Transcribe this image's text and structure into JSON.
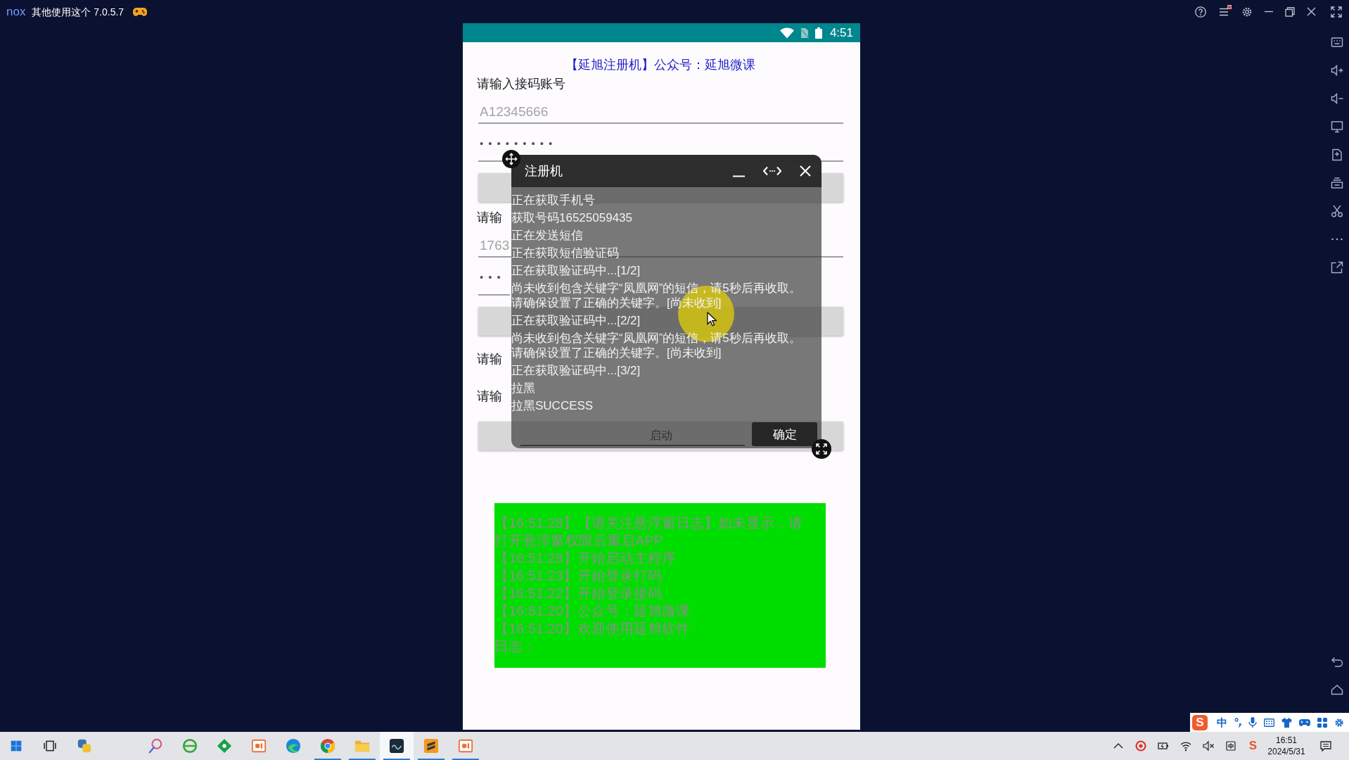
{
  "window": {
    "logo": "nox",
    "title": "其他使用这个 7.0.5.7",
    "menu_badge": true
  },
  "phone": {
    "status_bar": {
      "time": "4:51"
    },
    "heading": "【延旭注册机】公众号：延旭微课",
    "form": [
      {
        "kind": "label",
        "text": "请输入接码账号"
      },
      {
        "kind": "field",
        "placeholder": "A12345666"
      },
      {
        "kind": "password",
        "value": "•••••••••"
      },
      {
        "kind": "button"
      },
      {
        "kind": "label",
        "text": "请输"
      },
      {
        "kind": "field",
        "placeholder": "1763"
      },
      {
        "kind": "password",
        "value": "•••"
      },
      {
        "kind": "button"
      },
      {
        "kind": "row",
        "fields": [
          {
            "label": "请输"
          }
        ]
      },
      {
        "kind": "row",
        "fields": [
          {
            "label": "请输"
          }
        ]
      },
      {
        "kind": "button",
        "label": "启动"
      }
    ],
    "log": {
      "entries": [
        {
          "lines": [
            "【16:51:28】【请关注悬浮窗日志】如未显示，请",
            "打开悬浮窗权限后重启APP"
          ]
        },
        {
          "lines": [
            "【16:51:28】开始启动主程序"
          ]
        },
        {
          "lines": [
            "【16:51:23】开始登录打码"
          ]
        },
        {
          "lines": [
            "【16:51:22】开始登录接码"
          ]
        },
        {
          "lines": [
            "【16:51:20】公众号：延旭微课"
          ]
        },
        {
          "lines": [
            "【16:51:20】欢迎使用延旭软件"
          ]
        },
        {
          "lines": [
            "日志："
          ]
        }
      ]
    }
  },
  "float_window": {
    "title": "注册机",
    "entries": [
      {
        "lines": [
          "正在获取手机号"
        ]
      },
      {
        "lines": [
          "获取号码16525059435"
        ]
      },
      {
        "lines": [
          "正在发送短信"
        ]
      },
      {
        "lines": [
          "正在获取短信验证码"
        ]
      },
      {
        "lines": [
          "正在获取验证码中...[1/2]"
        ]
      },
      {
        "lines": [
          "尚未收到包含关键字“凤凰网”的短信，请5秒后再收取。",
          "请确保设置了正确的关键字。[尚未收到]"
        ]
      },
      {
        "lines": [
          "正在获取验证码中...[2/2]"
        ]
      },
      {
        "lines": [
          "尚未收到包含关键字“凤凰网”的短信，请5秒后再收取。",
          "请确保设置了正确的关键字。[尚未收到]"
        ]
      },
      {
        "lines": [
          "正在获取验证码中...[3/2]"
        ]
      },
      {
        "lines": [
          "拉黑"
        ]
      },
      {
        "lines": [
          "拉黑SUCCESS"
        ]
      }
    ],
    "confirm_button": "确定"
  },
  "ime_bar": {
    "logo": "S",
    "mode": "中"
  },
  "taskbar": {
    "apps": [
      {
        "kind": "start",
        "running": false,
        "selected": false
      },
      {
        "kind": "taskview",
        "running": false,
        "selected": false
      },
      {
        "kind": "snake",
        "running": false,
        "selected": false
      },
      {
        "kind": "brush",
        "running": false,
        "selected": false
      },
      {
        "kind": "orbit",
        "running": false,
        "selected": false
      },
      {
        "kind": "diamond",
        "running": false,
        "selected": false
      },
      {
        "kind": "slides",
        "running": false,
        "selected": false
      },
      {
        "kind": "swirl",
        "running": false,
        "selected": false
      },
      {
        "kind": "wheel",
        "running": true,
        "selected": false
      },
      {
        "kind": "folder",
        "running": true,
        "selected": false
      },
      {
        "kind": "emulator",
        "running": true,
        "selected": true
      },
      {
        "kind": "editor",
        "running": true,
        "selected": false
      },
      {
        "kind": "slides",
        "running": true,
        "selected": false
      }
    ],
    "tray": {
      "ime_logo": "S",
      "time": "16:51",
      "date": "2024/5/31"
    }
  }
}
